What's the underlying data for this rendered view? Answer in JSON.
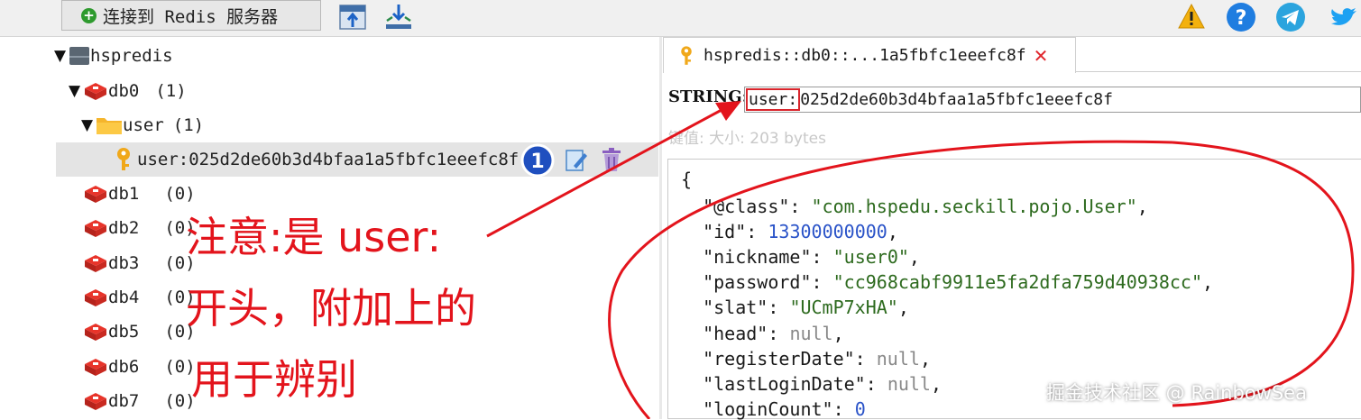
{
  "toolbar": {
    "connect_label": "连接到 Redis 服务器",
    "icons": [
      "import-icon",
      "export-icon",
      "warning-icon",
      "help-icon",
      "telegram-icon",
      "twitter-icon"
    ]
  },
  "tree": {
    "connection": "hspredis",
    "db0": {
      "name": "db0",
      "count": "(1)"
    },
    "folder": {
      "name": "user",
      "count": "(1)"
    },
    "key": "user:025d2de60b3d4bfaa1a5fbfc1eeefc8f",
    "badge": "1",
    "dbs": [
      {
        "name": "db1",
        "count": "(0)"
      },
      {
        "name": "db2",
        "count": "(0)"
      },
      {
        "name": "db3",
        "count": "(0)"
      },
      {
        "name": "db4",
        "count": "(0)"
      },
      {
        "name": "db5",
        "count": "(0)"
      },
      {
        "name": "db6",
        "count": "(0)"
      },
      {
        "name": "db7",
        "count": "(0)"
      }
    ]
  },
  "tab": {
    "title": "hspredis::db0::...1a5fbfc1eeefc8f"
  },
  "key_view": {
    "type_label": "STRING:",
    "key_prefix": "user:",
    "key_rest": "025d2de60b3d4bfaa1a5fbfc1eeefc8f",
    "meta": "键值: 大小: 203 bytes"
  },
  "json": {
    "open": "{",
    "lines": [
      {
        "k": "\"@class\"",
        "v": "\"com.hspedu.seckill.pojo.User\"",
        "t": "str",
        "c": ","
      },
      {
        "k": "\"id\"",
        "v": "13300000000",
        "t": "num",
        "c": ","
      },
      {
        "k": "\"nickname\"",
        "v": "\"user0\"",
        "t": "str",
        "c": ","
      },
      {
        "k": "\"password\"",
        "v": "\"cc968cabf9911e5fa2dfa759d40938cc\"",
        "t": "str",
        "c": ","
      },
      {
        "k": "\"slat\"",
        "v": "\"UCmP7xHA\"",
        "t": "str",
        "c": ","
      },
      {
        "k": "\"head\"",
        "v": "null",
        "t": "null",
        "c": ","
      },
      {
        "k": "\"registerDate\"",
        "v": "null",
        "t": "null",
        "c": ","
      },
      {
        "k": "\"lastLoginDate\"",
        "v": "null",
        "t": "null",
        "c": ","
      },
      {
        "k": "\"loginCount\"",
        "v": "0",
        "t": "num",
        "c": ""
      }
    ]
  },
  "annotation": {
    "line1": "注意:是 user:",
    "line2": "开头，附加上的",
    "line3": "用于辨别"
  },
  "watermark": "掘金技术社区 @ RainbowSea",
  "colors": {
    "annotation_red": "#e3141c",
    "string_green": "#2d6a1e",
    "number_blue": "#2a53c8"
  }
}
